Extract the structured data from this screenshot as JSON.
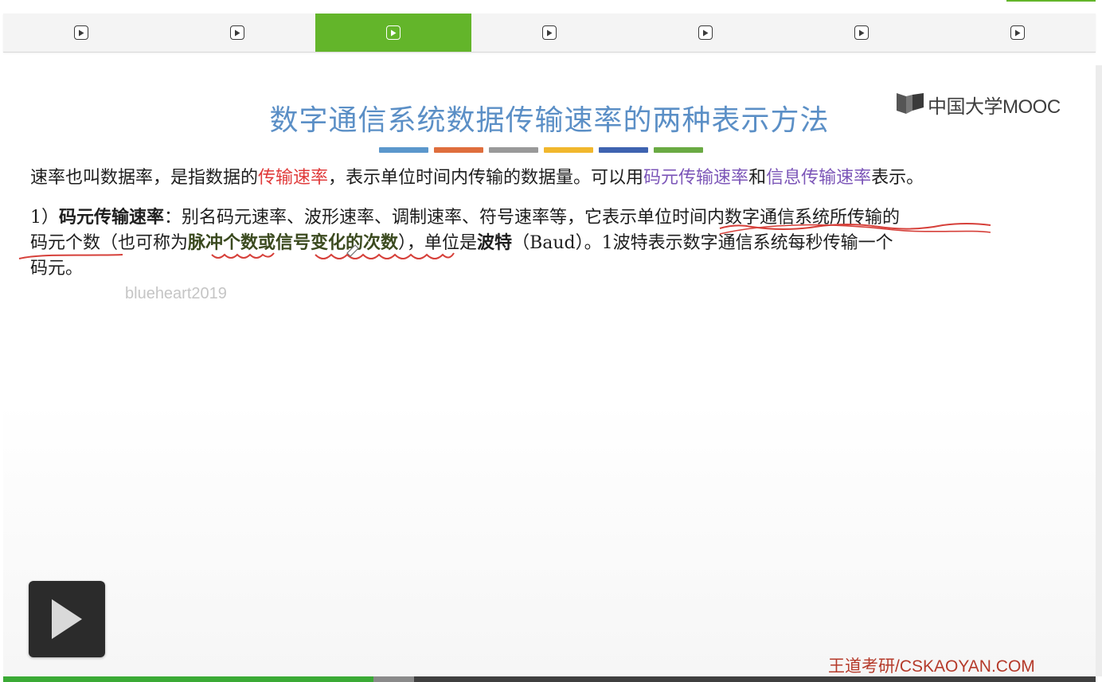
{
  "tabs": [
    {
      "icon": "play-icon",
      "active": false
    },
    {
      "icon": "play-icon",
      "active": false
    },
    {
      "icon": "play-icon",
      "active": true
    },
    {
      "icon": "play-icon",
      "active": false
    },
    {
      "icon": "play-icon",
      "active": false
    },
    {
      "icon": "play-icon",
      "active": false
    },
    {
      "icon": "play-icon",
      "active": false
    }
  ],
  "slide": {
    "title": "数字通信系统数据传输速率的两种表示方法",
    "logo_text": "中国大学MOOC",
    "color_bars": [
      "#5b97cc",
      "#df6e3d",
      "#999999",
      "#f1b72d",
      "#3e63b0",
      "#6aaa43"
    ],
    "paragraph1": [
      {
        "text": "速率也叫数据率，是指数据的",
        "style": "normal"
      },
      {
        "text": "传输速率",
        "style": "red"
      },
      {
        "text": "，表示单位时间内传输的数据量。可以用",
        "style": "normal"
      },
      {
        "text": "码元传输速率",
        "style": "purple"
      },
      {
        "text": "和",
        "style": "normal"
      },
      {
        "text": "信息传输速率",
        "style": "purple"
      },
      {
        "text": "表示。",
        "style": "normal"
      }
    ],
    "paragraph2": {
      "line1": [
        {
          "text": "1）",
          "style": "normal"
        },
        {
          "text": "码元传输速率",
          "style": "bold"
        },
        {
          "text": "：别名码元速率、波形速率、调制速率、符号速率等，它表示单位时间内数字通信系统所传输的",
          "style": "normal"
        }
      ],
      "line2": [
        {
          "text": "码元个数（也可称为",
          "style": "normal"
        },
        {
          "text": "脉冲个数或信号变化的次数",
          "style": "olive"
        },
        {
          "text": "），单位是",
          "style": "normal"
        },
        {
          "text": "波特",
          "style": "bold"
        },
        {
          "text": "（Baud）。1波特表示数字通信系统每秒传输一个",
          "style": "normal"
        }
      ],
      "line3": [
        {
          "text": "码元。",
          "style": "normal"
        }
      ]
    },
    "watermark": "blueheart2019",
    "bottom_brand": "王道考研/CSKAOYAN.COM"
  },
  "player": {
    "big_play_icon": "play-icon",
    "progress_played_fraction": 0.339,
    "progress_buffered_fraction": 0.376,
    "colors": {
      "accent": "#63b52a",
      "played": "#3aaa35"
    }
  }
}
